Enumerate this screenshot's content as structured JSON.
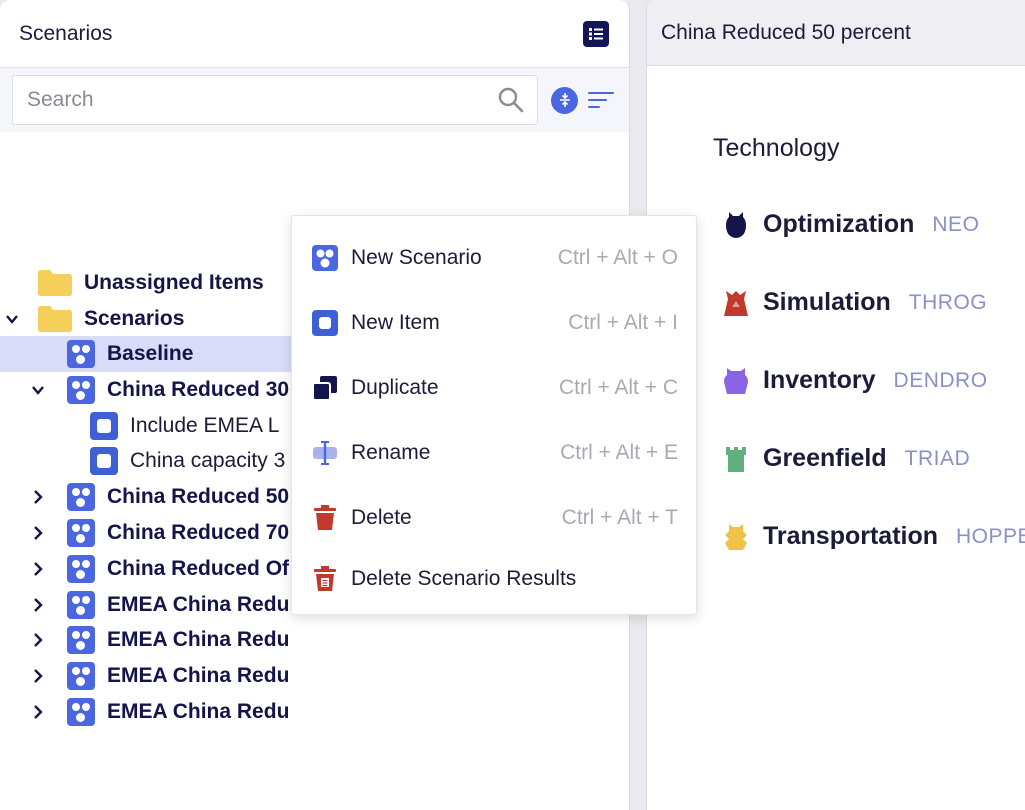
{
  "left_panel": {
    "title": "Scenarios",
    "search": {
      "placeholder": "Search",
      "value": ""
    },
    "tree": [
      {
        "label": "Unassigned Items",
        "kind": "folder",
        "weight": "bold",
        "chevron": "none"
      },
      {
        "label": "Scenarios",
        "kind": "folder",
        "weight": "bold",
        "chevron": "down"
      },
      {
        "label": "Baseline",
        "kind": "scenario",
        "weight": "bold",
        "chevron": "none",
        "selected": true
      },
      {
        "label": "China Reduced 30",
        "kind": "scenario",
        "weight": "bold",
        "chevron": "down"
      },
      {
        "label": "Include EMEA L",
        "kind": "item",
        "weight": "normal",
        "chevron": "none"
      },
      {
        "label": "China capacity 3",
        "kind": "item",
        "weight": "normal",
        "chevron": "none"
      },
      {
        "label": "China Reduced 50",
        "kind": "scenario",
        "weight": "bold",
        "chevron": "right"
      },
      {
        "label": "China Reduced 70",
        "kind": "scenario",
        "weight": "bold",
        "chevron": "right"
      },
      {
        "label": "China Reduced Of",
        "kind": "scenario",
        "weight": "bold",
        "chevron": "right"
      },
      {
        "label": "EMEA China Redu",
        "kind": "scenario",
        "weight": "bold",
        "chevron": "right"
      },
      {
        "label": "EMEA China Redu",
        "kind": "scenario",
        "weight": "bold",
        "chevron": "right"
      },
      {
        "label": "EMEA China Redu",
        "kind": "scenario",
        "weight": "bold",
        "chevron": "right"
      },
      {
        "label": "EMEA China Redu",
        "kind": "scenario",
        "weight": "bold",
        "chevron": "right"
      }
    ]
  },
  "context_menu": {
    "items": [
      {
        "label": "New Scenario",
        "shortcut": "Ctrl + Alt + O",
        "icon": "new-scenario-icon"
      },
      {
        "label": "New Item",
        "shortcut": "Ctrl + Alt + I",
        "icon": "new-item-icon"
      },
      {
        "label": "Duplicate",
        "shortcut": "Ctrl + Alt + C",
        "icon": "duplicate-icon"
      },
      {
        "label": "Rename",
        "shortcut": "Ctrl + Alt + E",
        "icon": "rename-icon"
      },
      {
        "label": "Delete",
        "shortcut": "Ctrl + Alt + T",
        "icon": "delete-icon"
      },
      {
        "label": "Delete Scenario Results",
        "shortcut": "",
        "icon": "delete-results-icon"
      }
    ]
  },
  "right_panel": {
    "title": "China Reduced 50 percent",
    "section_title": "Technology",
    "technologies": [
      {
        "name": "Optimization",
        "code": "NEO",
        "color": "#14144a",
        "icon": "optimization-icon"
      },
      {
        "name": "Simulation",
        "code": "THROG",
        "color": "#c0392b",
        "icon": "simulation-icon"
      },
      {
        "name": "Inventory",
        "code": "DENDRO",
        "color": "#8a63e6",
        "icon": "inventory-icon"
      },
      {
        "name": "Greenfield",
        "code": "TRIAD",
        "color": "#5fb07a",
        "icon": "greenfield-icon"
      },
      {
        "name": "Transportation",
        "code": "HOPPE",
        "color": "#f0c24a",
        "icon": "transportation-icon"
      }
    ]
  },
  "colors": {
    "accent": "#4a66e0",
    "navy": "#14144a",
    "selected_row": "#d9dcf8",
    "danger": "#c0392b",
    "folder": "#f5cf5a"
  }
}
